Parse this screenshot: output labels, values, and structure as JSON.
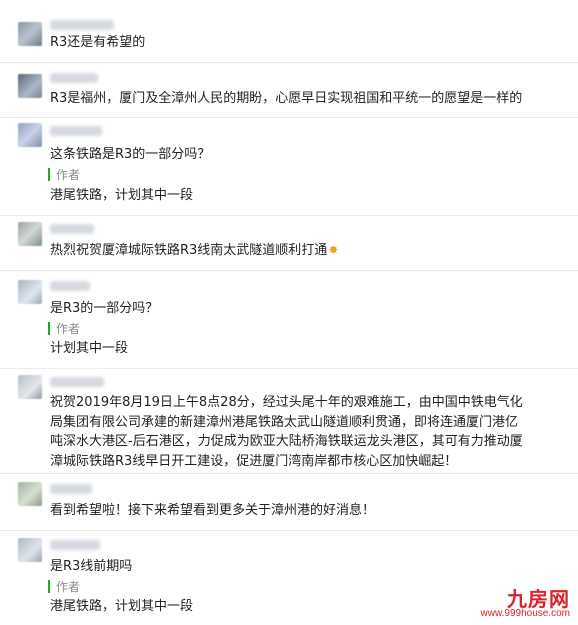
{
  "comments": [
    {
      "text": "R3还是有希望的"
    },
    {
      "text": "R3是福州，厦门及全漳州人民的期盼，心愿早日实现祖国和平统一的愿望是一样的"
    },
    {
      "text": "这条铁路是R3的一部分吗？",
      "author_label": "作者",
      "reply": "港尾铁路，计划其中一段"
    },
    {
      "text": "热烈祝贺厦漳城际铁路R3线南太武隧道顺利打通",
      "emoji": "party-popper-icon"
    },
    {
      "text": "是R3的一部分吗？",
      "author_label": "作者",
      "reply": "计划其中一段"
    },
    {
      "text": "祝贺2019年8月19日上午8点28分，经过头尾十年的艰难施工，由中国中铁电气化局集团有限公司承建的新建漳州港尾铁路太武山隧道顺利贯通，即将连通厦门港亿吨深水大港区-后石港区，力促成为欧亚大陆桥海铁联运龙头港区，其可有力推动厦漳城际铁路R3线早日开工建设，促进厦门湾南岸都市核心区加快崛起！"
    },
    {
      "text": "看到希望啦！接下来希望看到更多关于漳州港的好消息！"
    },
    {
      "text": "是R3线前期吗",
      "author_label": "作者",
      "reply": "港尾铁路，计划其中一段"
    }
  ],
  "watermark": {
    "title": "九房网",
    "url": "www.999house.com"
  },
  "colors": {
    "author_bar": "#1aad19",
    "watermark": "#d9232a"
  }
}
